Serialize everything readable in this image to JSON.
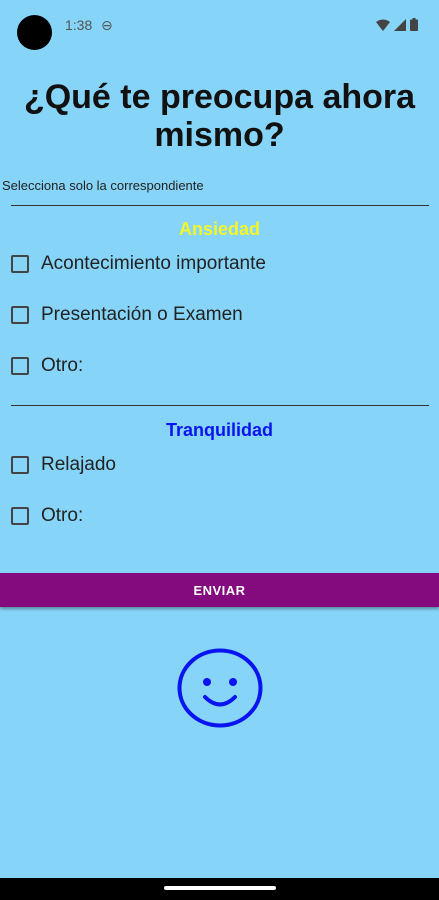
{
  "status_bar": {
    "time": "1:38"
  },
  "title": "¿Qué te preocupa ahora mismo?",
  "subtitle": "Selecciona solo la correspondiente",
  "sections": [
    {
      "title": "Ansiedad",
      "color": "#f5f52a",
      "options": [
        "Acontecimiento importante",
        "Presentación o Examen",
        "Otro:"
      ]
    },
    {
      "title": "Tranquilidad",
      "color": "#0a14f0",
      "options": [
        "Relajado",
        "Otro:"
      ]
    }
  ],
  "submit_label": "ENVIAR",
  "colors": {
    "background": "#86d4f7",
    "button": "#830b7d",
    "face": "#0a14f0"
  },
  "icons": [
    "camera-dot",
    "settings-icon",
    "wifi-icon",
    "signal-icon",
    "battery-icon",
    "smiley-face-icon"
  ]
}
